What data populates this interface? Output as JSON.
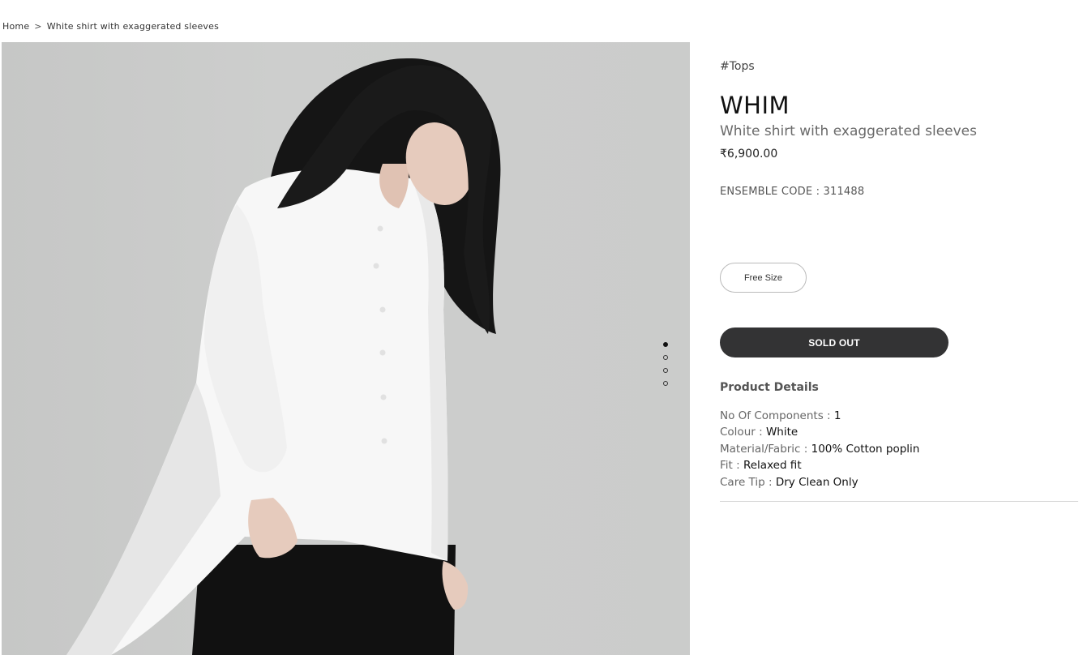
{
  "breadcrumb": {
    "home": "Home",
    "separator": ">",
    "current": "White shirt with exaggerated sleeves"
  },
  "product": {
    "category_tag": "#Tops",
    "brand": "WHIM",
    "name": "White shirt with exaggerated sleeves",
    "price": "₹6,900.00",
    "ensemble_code": "ENSEMBLE CODE : 311488",
    "size_option": "Free Size",
    "cta_label": "SOLD OUT"
  },
  "gallery": {
    "image_count": 4,
    "active_index": 0,
    "colors": {
      "background": "#c9cac9",
      "shirt": "#f7f7f7",
      "skirt": "#111111",
      "hair": "#151515",
      "skin": "#e6cbbd"
    }
  },
  "details": {
    "title": "Product Details",
    "items": [
      {
        "label": "No Of Components :",
        "value": "1"
      },
      {
        "label": "Colour :",
        "value": "White"
      },
      {
        "label": "Material/Fabric :",
        "value": "100% Cotton poplin"
      },
      {
        "label": "Fit :",
        "value": "Relaxed fit"
      },
      {
        "label": "Care Tip :",
        "value": "Dry Clean Only"
      }
    ]
  },
  "colors": {
    "cta_background": "#333334",
    "cta_text": "#ffffff",
    "divider": "#d6d6d6"
  }
}
